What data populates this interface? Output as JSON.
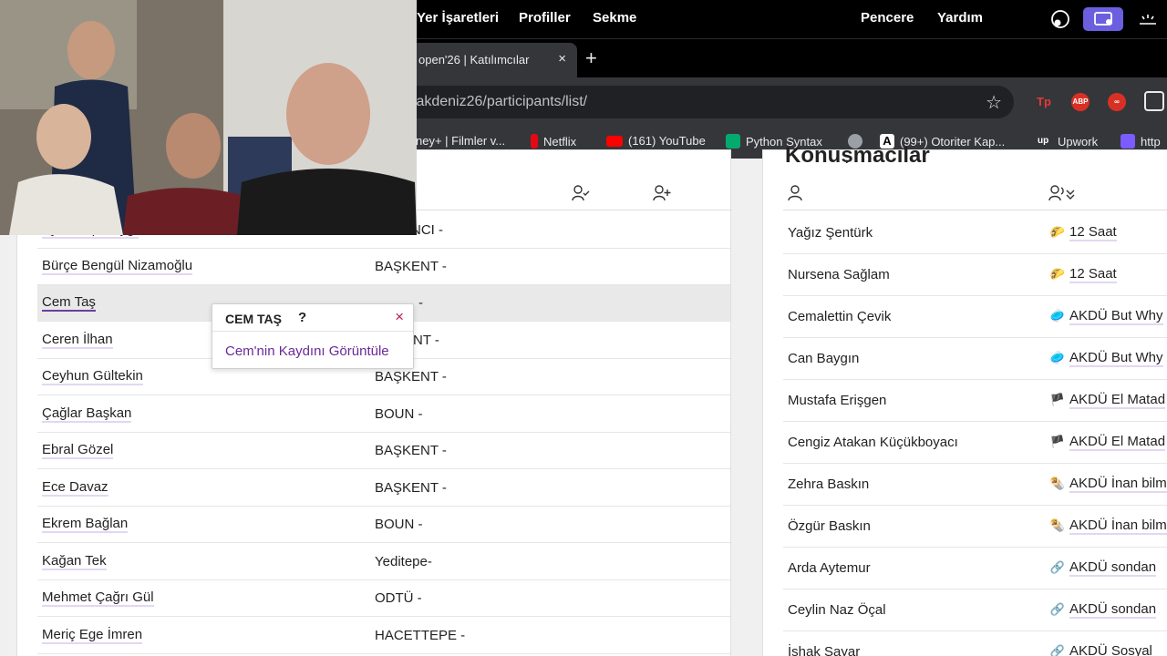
{
  "menubar": {
    "items": [
      "Yer İşaretleri",
      "Profiller",
      "Sekme",
      "Pencere",
      "Yardım"
    ]
  },
  "browser": {
    "tab_title": "open'26 | Katılımcılar",
    "tab_close": "×",
    "new_tab": "+",
    "url": "/akdeniz26/participants/list/",
    "bookmarks": [
      {
        "label": "ney+ | Filmler v...",
        "icon": "disney-icon",
        "color": "#35363a"
      },
      {
        "label": "Netflix",
        "icon": "netflix-icon",
        "color": "#e50914"
      },
      {
        "label": "(161) YouTube",
        "icon": "youtube-icon",
        "color": "#ff0000"
      },
      {
        "label": "Python Syntax",
        "icon": "w3schools-icon",
        "color": "#04aa6d"
      },
      {
        "label": "",
        "icon": "globe-icon",
        "color": "#9aa0a6"
      },
      {
        "label": "(99+) Otoriter Kap...",
        "icon": "a-letter-icon",
        "color": "#ffffff"
      },
      {
        "label": "Upwork",
        "icon": "upwork-icon",
        "color": "#35363a"
      },
      {
        "label": "http",
        "icon": "messenger-icon",
        "color": "#7b5cff"
      }
    ],
    "extensions": [
      {
        "label": "Tp",
        "color": "#d93025"
      },
      {
        "label": "ABP",
        "color": "#d93025"
      },
      {
        "label": "∞",
        "color": "#d93025"
      }
    ]
  },
  "left_table": {
    "rows": [
      {
        "name": "Aydın Alp Saygı",
        "uni": "SABANCI -"
      },
      {
        "name": "Bürçe Bengül Nizamoğlu",
        "uni": "BAŞKENT -"
      },
      {
        "name": "Cem Taş",
        "uni": "-"
      },
      {
        "name": "Ceren İlhan",
        "uni": "NT -"
      },
      {
        "name": "Ceyhun Gültekin",
        "uni": "BAŞKENT -"
      },
      {
        "name": "Çağlar Başkan",
        "uni": "BOUN -"
      },
      {
        "name": "Ebral Gözel",
        "uni": "BAŞKENT -"
      },
      {
        "name": "Ece Davaz",
        "uni": "BAŞKENT -"
      },
      {
        "name": "Ekrem Bağlan",
        "uni": "BOUN -"
      },
      {
        "name": "Kağan Tek",
        "uni": "Yeditepe-"
      },
      {
        "name": "Mehmet Çağrı Gül",
        "uni": "ODTÜ -"
      },
      {
        "name": "Meriç Ege İmren",
        "uni": "HACETTEPE -"
      }
    ]
  },
  "popover": {
    "title": "CEM TAŞ",
    "help": "?",
    "close": "×",
    "link": "Cem'nin Kaydını Görüntüle"
  },
  "right_panel": {
    "title": "Konuşmacılar",
    "rows": [
      {
        "name": "Yağız Şentürk",
        "mentor": "12 Saat",
        "emoji": "🌮"
      },
      {
        "name": "Nursena Sağlam",
        "mentor": "12 Saat",
        "emoji": "🌮"
      },
      {
        "name": "Cemalettin Çevik",
        "mentor": "AKDÜ But Why",
        "emoji": "🥏"
      },
      {
        "name": "Can Baygın",
        "mentor": "AKDÜ But Why",
        "emoji": "🥏"
      },
      {
        "name": "Mustafa Erişgen",
        "mentor": "AKDÜ El Matad",
        "emoji": "🏴"
      },
      {
        "name": "Cengiz Atakan Küçükboyacı",
        "mentor": "AKDÜ El Matad",
        "emoji": "🏴"
      },
      {
        "name": "Zehra Baskın",
        "mentor": "AKDÜ İnan bilm",
        "emoji": "🌯"
      },
      {
        "name": "Özgür Baskın",
        "mentor": "AKDÜ İnan bilm",
        "emoji": "🌯"
      },
      {
        "name": "Arda Aytemur",
        "mentor": "AKDÜ sondan",
        "emoji": "🔗"
      },
      {
        "name": "Ceylin Naz Öçal",
        "mentor": "AKDÜ sondan",
        "emoji": "🔗"
      },
      {
        "name": "İshak Sayar",
        "mentor": "AKDÜ Sosyal",
        "emoji": "🔗"
      }
    ]
  },
  "colors": {
    "accent": "#6a2a9a",
    "close": "#c2185b"
  }
}
